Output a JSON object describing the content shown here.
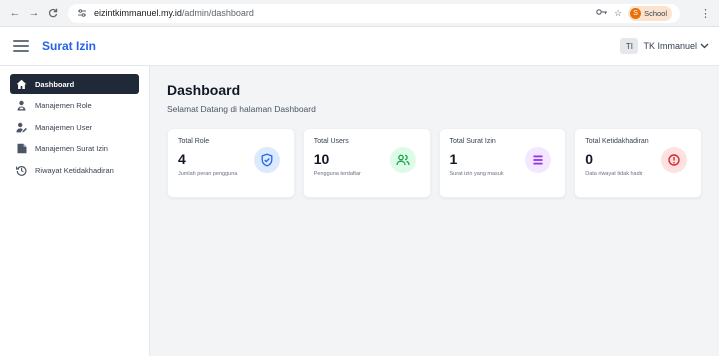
{
  "browser": {
    "url_domain": "eizintkimmanuel.my.id",
    "url_path": "/admin/dashboard",
    "profile_label": "School",
    "profile_initial": "S"
  },
  "header": {
    "app_title": "Surat Izin",
    "user_initials": "TI",
    "user_name": "TK Immanuel"
  },
  "sidebar": {
    "items": [
      {
        "label": "Dashboard",
        "icon": "home-icon",
        "active": true
      },
      {
        "label": "Manajemen Role",
        "icon": "user-badge-icon",
        "active": false
      },
      {
        "label": "Manajemen User",
        "icon": "user-edit-icon",
        "active": false
      },
      {
        "label": "Manajemen Surat Izin",
        "icon": "document-icon",
        "active": false
      },
      {
        "label": "Riwayat Ketidakhadiran",
        "icon": "history-icon",
        "active": false
      }
    ]
  },
  "main": {
    "title": "Dashboard",
    "subtitle": "Selamat Datang di halaman Dashboard",
    "cards": [
      {
        "title": "Total Role",
        "value": "4",
        "desc": "Jumlah peran pengguna",
        "icon": "shield-check-icon",
        "color": "#2563eb",
        "bg": "#dbeafe"
      },
      {
        "title": "Total Users",
        "value": "10",
        "desc": "Pengguna terdaftar",
        "icon": "users-icon",
        "color": "#16a34a",
        "bg": "#dcfce7"
      },
      {
        "title": "Total Surat Izin",
        "value": "1",
        "desc": "Surat izin yang masuk",
        "icon": "list-icon",
        "color": "#9333ea",
        "bg": "#f3e8ff"
      },
      {
        "title": "Total Ketidakhadiran",
        "value": "0",
        "desc": "Data riwayat tidak hadir",
        "icon": "alert-circle-icon",
        "color": "#dc2626",
        "bg": "#fee2e2"
      }
    ]
  }
}
